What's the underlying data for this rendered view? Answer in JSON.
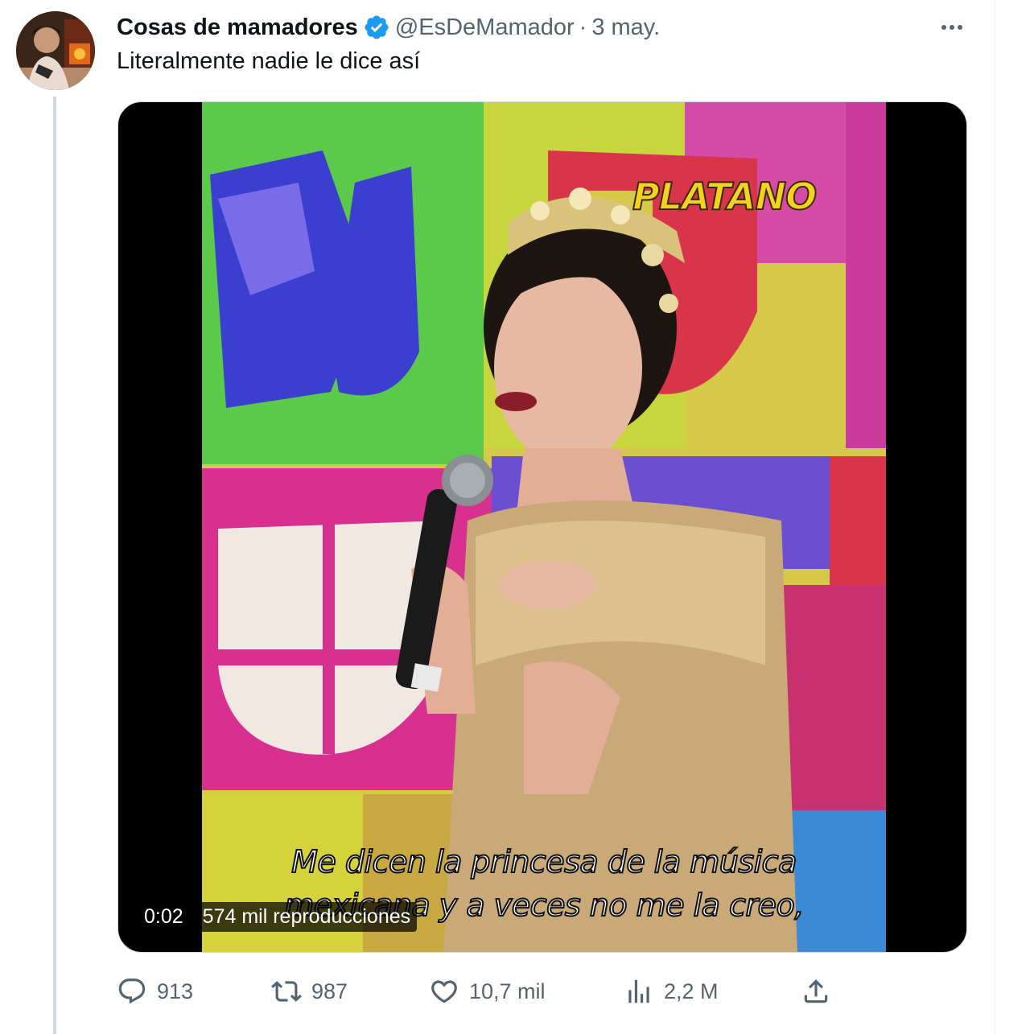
{
  "tweet": {
    "author": {
      "display_name": "Cosas de mamadores",
      "verified_icon": "verified-badge-icon",
      "handle": "@EsDeMamador",
      "separator": "·",
      "date": "3 may."
    },
    "more_icon": "more-horizontal-icon",
    "text": "Literalmente nadie le dice así",
    "media": {
      "type": "video",
      "overlay_logo": "PLATANO",
      "subtitle_line1": "Me dicen la princesa de la música",
      "subtitle_line2": "mexicana y a veces no me la creo,",
      "elapsed": "0:02",
      "views": "574 mil reproducciones"
    },
    "actions": {
      "reply": {
        "icon": "reply-icon",
        "count": "913"
      },
      "retweet": {
        "icon": "retweet-icon",
        "count": "987"
      },
      "like": {
        "icon": "heart-icon",
        "count": "10,7 mil"
      },
      "views": {
        "icon": "analytics-icon",
        "count": "2,2 M"
      },
      "share": {
        "icon": "share-icon"
      }
    }
  },
  "colors": {
    "text_primary": "#0f1419",
    "text_secondary": "#536471",
    "verified_blue": "#1d9bf0",
    "thread_line": "#cfd9de"
  }
}
